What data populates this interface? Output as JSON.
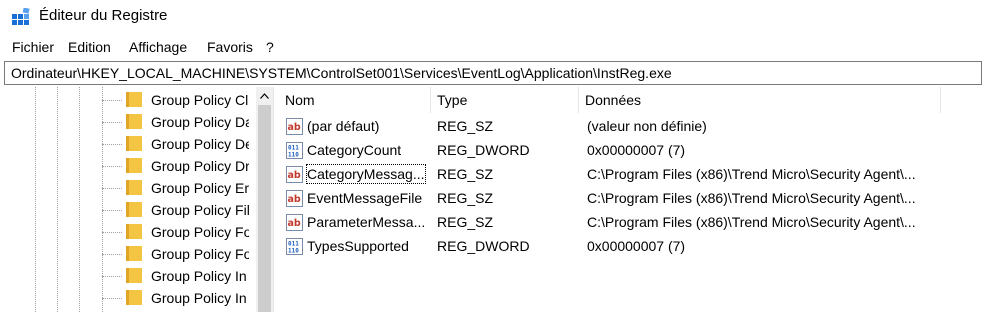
{
  "window": {
    "title": "Éditeur du Registre"
  },
  "menu": [
    "Fichier",
    "Edition",
    "Affichage",
    "Favoris",
    "?"
  ],
  "address": "Ordinateur\\HKEY_LOCAL_MACHINE\\SYSTEM\\ControlSet001\\Services\\EventLog\\Application\\InstReg.exe",
  "tree": {
    "items": [
      "Group Policy Cl",
      "Group Policy Da",
      "Group Policy De",
      "Group Policy Dr",
      "Group Policy Er",
      "Group Policy Fil",
      "Group Policy Fo",
      "Group Policy Fo",
      "Group Policy In",
      "Group Policy In"
    ]
  },
  "list": {
    "columns": [
      "Nom",
      "Type",
      "Données"
    ],
    "rows": [
      {
        "icon": "string-value-icon",
        "name": "(par défaut)",
        "type": "REG_SZ",
        "data": "(valeur non définie)"
      },
      {
        "icon": "dword-value-icon",
        "name": "CategoryCount",
        "type": "REG_DWORD",
        "data": "0x00000007 (7)"
      },
      {
        "icon": "string-value-icon",
        "name": "CategoryMessag...",
        "type": "REG_SZ",
        "data": "C:\\Program Files (x86)\\Trend Micro\\Security Agent\\..."
      },
      {
        "icon": "string-value-icon",
        "name": "EventMessageFile",
        "type": "REG_SZ",
        "data": "C:\\Program Files (x86)\\Trend Micro\\Security Agent\\..."
      },
      {
        "icon": "string-value-icon",
        "name": "ParameterMessa...",
        "type": "REG_SZ",
        "data": "C:\\Program Files (x86)\\Trend Micro\\Security Agent\\..."
      },
      {
        "icon": "dword-value-icon",
        "name": "TypesSupported",
        "type": "REG_DWORD",
        "data": "0x00000007 (7)"
      }
    ]
  },
  "colors": {
    "folder": "#f4c542",
    "string_icon_red": "#c0392b",
    "dword_icon_blue": "#1f5fbf"
  }
}
